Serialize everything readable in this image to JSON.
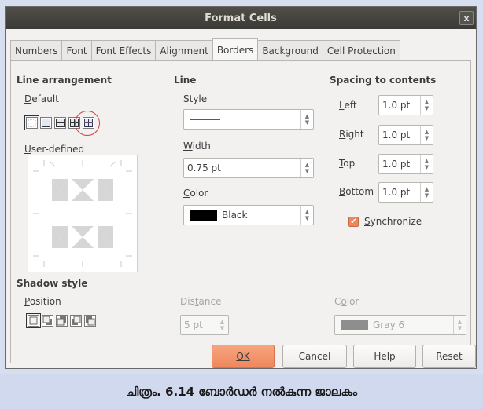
{
  "window": {
    "title": "Format Cells",
    "close_glyph": "x"
  },
  "tabs": [
    {
      "label": "Numbers"
    },
    {
      "label": "Font"
    },
    {
      "label": "Font Effects"
    },
    {
      "label": "Alignment"
    },
    {
      "label": "Borders",
      "active": true
    },
    {
      "label": "Background"
    },
    {
      "label": "Cell Protection"
    }
  ],
  "line_arrangement": {
    "heading": "Line arrangement",
    "default_label": "Default",
    "user_defined_label": "User-defined"
  },
  "line": {
    "heading": "Line",
    "style_label": "Style",
    "width_label": "Width",
    "width_value": "0.75 pt",
    "color_label": "Color",
    "color_value": "Black",
    "color_swatch": "#000000"
  },
  "spacing": {
    "heading": "Spacing to contents",
    "left_label": "Left",
    "left_value": "1.0 pt",
    "right_label": "Right",
    "right_value": "1.0 pt",
    "top_label": "Top",
    "top_value": "1.0 pt",
    "bottom_label": "Bottom",
    "bottom_value": "1.0 pt",
    "synchronize_label": "Synchronize",
    "synchronize_checked": true
  },
  "shadow": {
    "heading": "Shadow style",
    "position_label": "Position",
    "distance_label": "Distance",
    "distance_value": "5 pt",
    "color_label": "Color",
    "color_value": "Gray 6",
    "color_swatch": "#8e8e8e"
  },
  "buttons": {
    "ok": "OK",
    "cancel": "Cancel",
    "help": "Help",
    "reset": "Reset"
  },
  "caption": "ചിത്രം. 6.14 ബോർഡർ നൽകുന്ന ജാലകം",
  "colors": {
    "accent": "#ef875c",
    "titlebar": "#3f3e3a",
    "annotation": "#d93a3a"
  }
}
